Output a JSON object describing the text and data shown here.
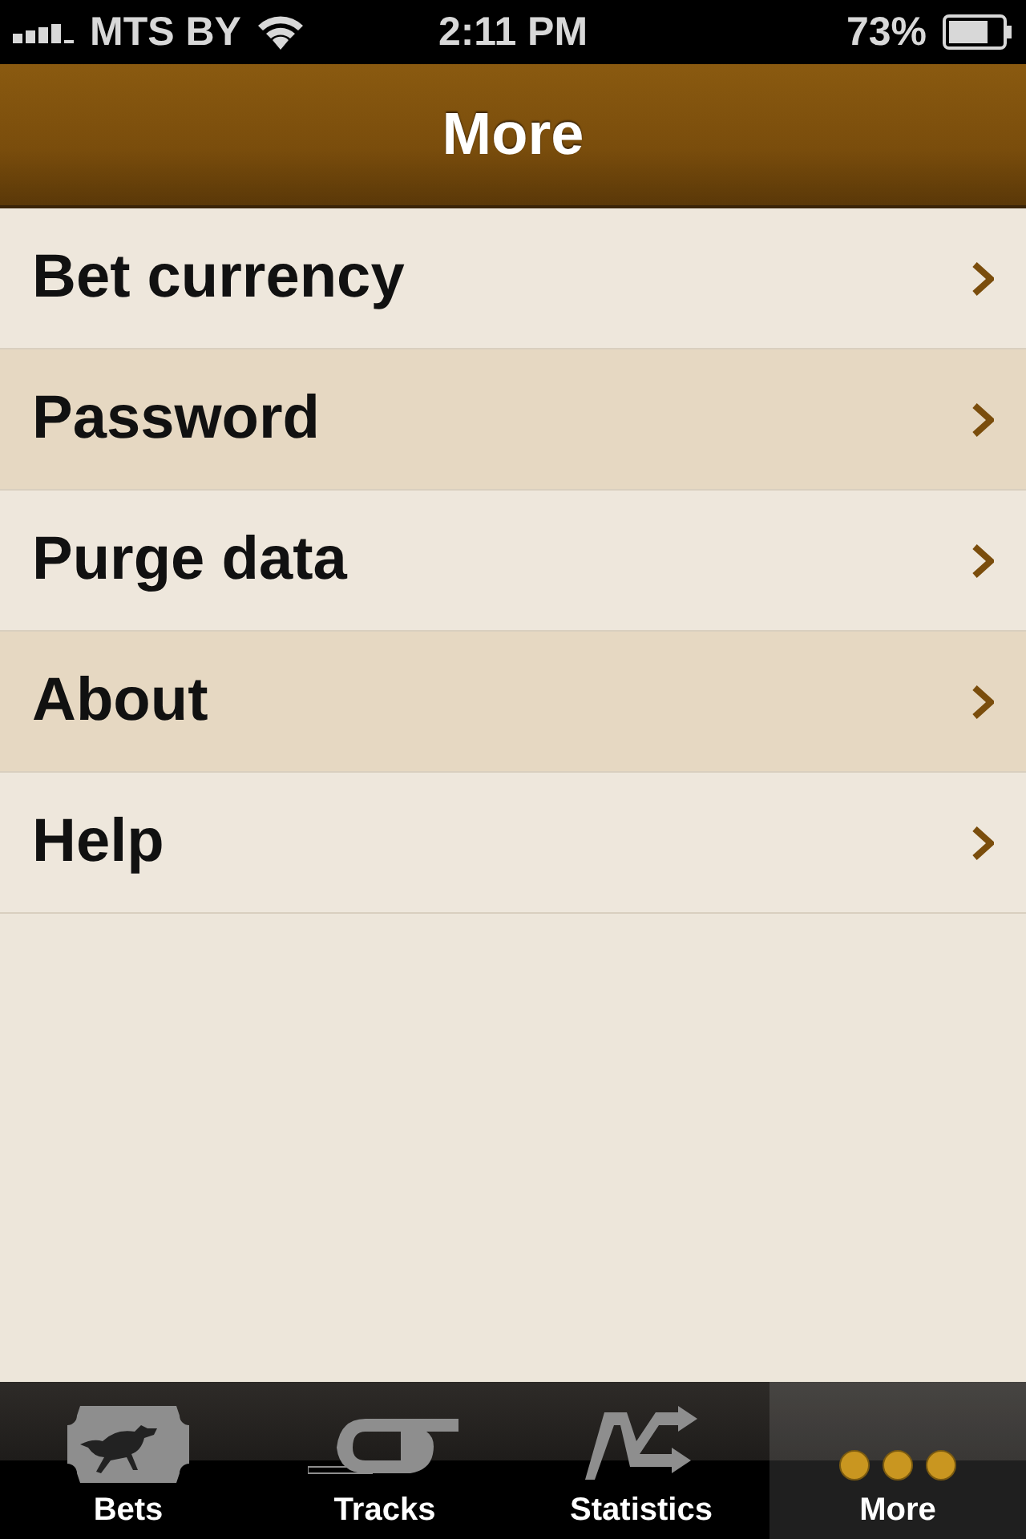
{
  "status_bar": {
    "carrier": "MTS BY",
    "time": "2:11 PM",
    "battery": "73%"
  },
  "nav_bar": {
    "title": "More"
  },
  "menu_items": [
    {
      "label": "Bet currency"
    },
    {
      "label": "Password"
    },
    {
      "label": "Purge data"
    },
    {
      "label": "About"
    },
    {
      "label": "Help"
    }
  ],
  "tabs": [
    {
      "label": "Bets",
      "kind": "horse",
      "selected": false
    },
    {
      "label": "Tracks",
      "kind": "track",
      "selected": false
    },
    {
      "label": "Statistics",
      "kind": "stats",
      "selected": false
    },
    {
      "label": "More",
      "kind": "more",
      "selected": true
    }
  ]
}
